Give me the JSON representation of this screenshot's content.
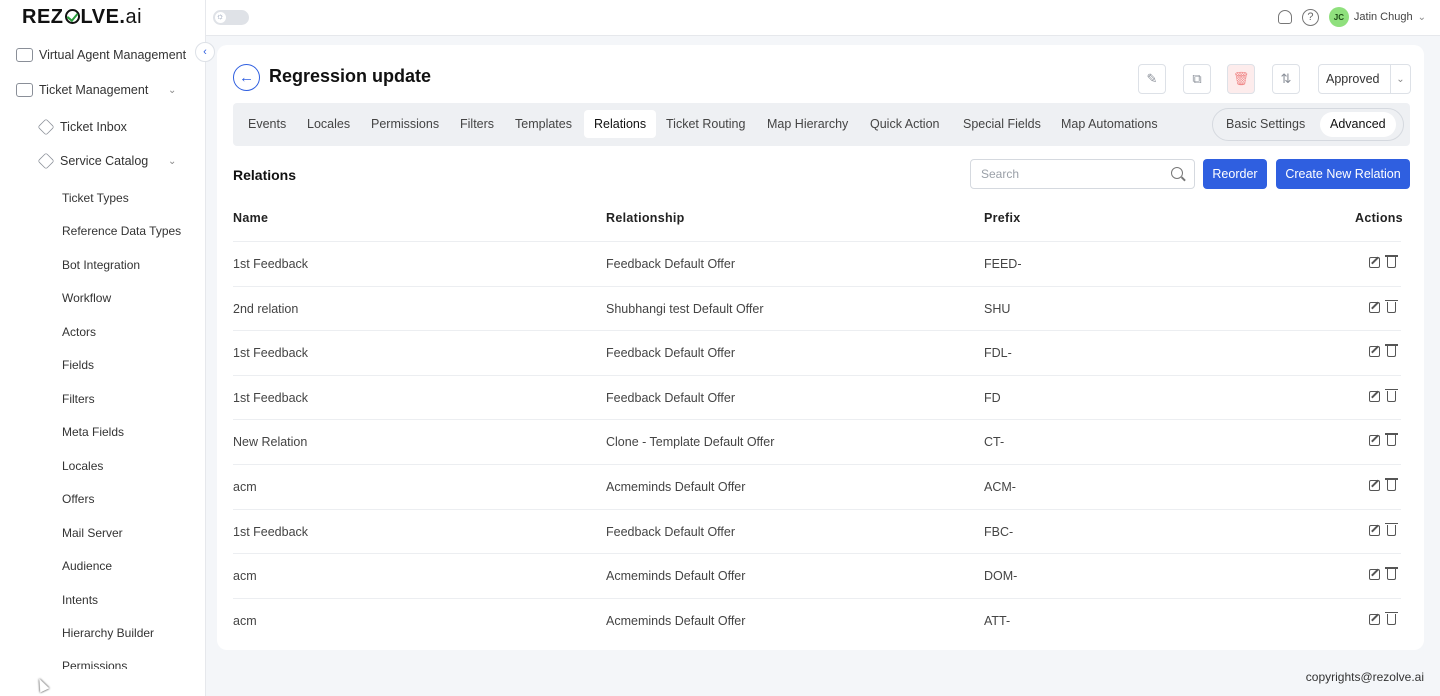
{
  "brand": {
    "logo_pre": "REZ",
    "logo_post": "LVE.",
    "logo_ai": "ai"
  },
  "sidebar": {
    "items": [
      {
        "label": "Virtual Agent Management"
      },
      {
        "label": "Ticket Management",
        "expanded": true
      }
    ],
    "sub_items": [
      {
        "label": "Ticket Inbox"
      },
      {
        "label": "Service Catalog",
        "expanded": true
      }
    ],
    "catalog_items": [
      {
        "label": "Ticket Types"
      },
      {
        "label": "Reference Data Types"
      },
      {
        "label": "Bot Integration"
      },
      {
        "label": "Workflow"
      },
      {
        "label": "Actors"
      },
      {
        "label": "Fields"
      },
      {
        "label": "Filters"
      },
      {
        "label": "Meta Fields"
      },
      {
        "label": "Locales"
      },
      {
        "label": "Offers"
      },
      {
        "label": "Mail Server"
      },
      {
        "label": "Audience"
      },
      {
        "label": "Intents"
      },
      {
        "label": "Hierarchy Builder"
      },
      {
        "label": "Permissions"
      }
    ]
  },
  "topbar": {
    "user_initials": "JC",
    "user_name": "Jatin Chugh"
  },
  "page": {
    "title": "Regression update",
    "status": "Approved",
    "tabs": [
      {
        "label": "Events"
      },
      {
        "label": "Locales"
      },
      {
        "label": "Permissions"
      },
      {
        "label": "Filters"
      },
      {
        "label": "Templates"
      },
      {
        "label": "Relations",
        "active": true
      },
      {
        "label": "Ticket Routing"
      },
      {
        "label": "Map Hierarchy"
      },
      {
        "label": "Quick Action"
      },
      {
        "label": "Special Fields"
      },
      {
        "label": "Map Automations"
      }
    ],
    "mode_options": [
      {
        "label": "Basic Settings"
      },
      {
        "label": "Advanced",
        "active": true
      }
    ]
  },
  "relations": {
    "section_title": "Relations",
    "search_placeholder": "Search",
    "reorder_label": "Reorder",
    "create_label": "Create New Relation",
    "columns": [
      "Name",
      "Relationship",
      "Prefix",
      "Actions"
    ],
    "rows": [
      {
        "name": "1st Feedback",
        "relationship": "Feedback Default Offer",
        "prefix": "FEED-"
      },
      {
        "name": "2nd relation",
        "relationship": "Shubhangi test Default Offer",
        "prefix": "SHU"
      },
      {
        "name": "1st Feedback",
        "relationship": "Feedback Default Offer",
        "prefix": "FDL-"
      },
      {
        "name": "1st Feedback",
        "relationship": "Feedback Default Offer",
        "prefix": "FD"
      },
      {
        "name": "New Relation",
        "relationship": "Clone - Template Default Offer",
        "prefix": "CT-"
      },
      {
        "name": "acm",
        "relationship": "Acmeminds Default Offer",
        "prefix": "ACM-"
      },
      {
        "name": "1st Feedback",
        "relationship": "Feedback Default Offer",
        "prefix": "FBC-"
      },
      {
        "name": "acm",
        "relationship": "Acmeminds Default Offer",
        "prefix": "DOM-"
      },
      {
        "name": "acm",
        "relationship": "Acmeminds Default Offer",
        "prefix": "ATT-"
      }
    ]
  },
  "footer": {
    "copyright": "copyrights@rezolve.ai"
  },
  "colors": {
    "primary": "#2f5fe0",
    "avatar": "#8fe07d",
    "delete_bg": "#fdecec"
  }
}
